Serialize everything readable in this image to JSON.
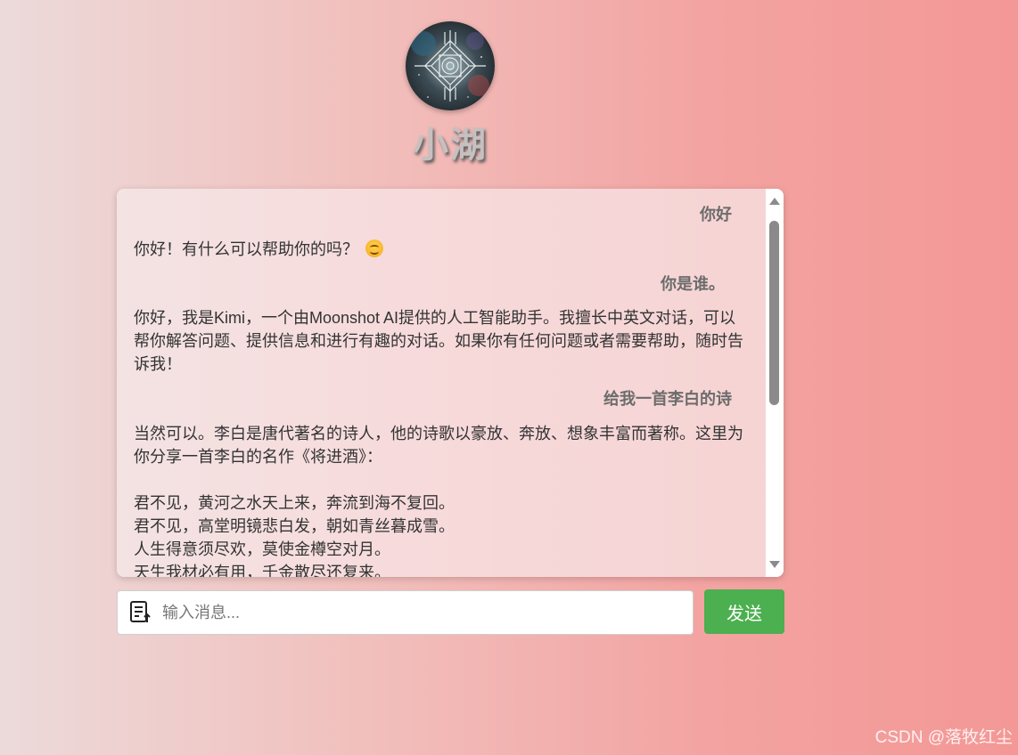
{
  "header": {
    "avatar_icon": "mandala-avatar-icon",
    "bot_name": "小湖"
  },
  "chat": {
    "messages": [
      {
        "role": "user",
        "text": "你好"
      },
      {
        "role": "bot",
        "text": "你好！有什么可以帮助你的吗？",
        "emoji": "smiling-face-icon"
      },
      {
        "role": "user",
        "text": "你是谁。"
      },
      {
        "role": "bot",
        "text": "你好，我是Kimi，一个由Moonshot AI提供的人工智能助手。我擅长中英文对话，可以帮你解答问题、提供信息和进行有趣的对话。如果你有任何问题或者需要帮助，随时告诉我！"
      },
      {
        "role": "user",
        "text": "给我一首李白的诗"
      },
      {
        "role": "bot",
        "lines": [
          "当然可以。李白是唐代著名的诗人，他的诗歌以豪放、奔放、想象丰富而著称。这里为你分享一首李白的名作《将进酒》：",
          "",
          "君不见，黄河之水天上来，奔流到海不复回。",
          "君不见，高堂明镜悲白发，朝如青丝暮成雪。",
          "人生得意须尽欢，莫使金樽空对月。",
          "天生我材必有用，千金散尽还复来。"
        ]
      }
    ],
    "scroll_position": 0.1
  },
  "composer": {
    "placeholder": "输入消息...",
    "value": "",
    "send_label": "发送",
    "input_icon": "document-edit-icon"
  },
  "colors": {
    "send_button": "#4caf50",
    "bg_left": "#ecdada",
    "bg_right": "#f39896"
  },
  "watermark": "CSDN @落牧红尘"
}
